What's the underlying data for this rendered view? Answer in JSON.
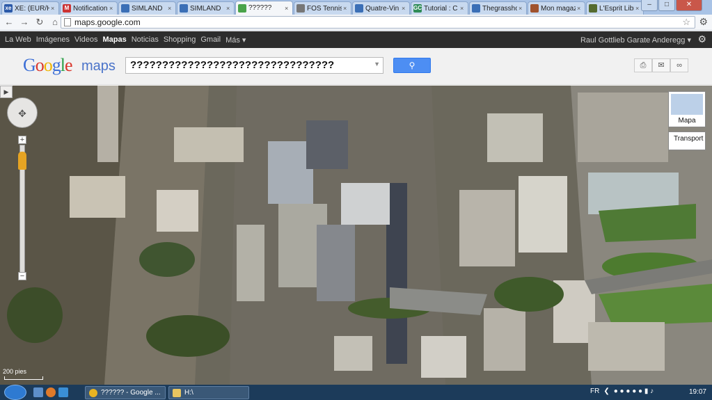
{
  "browser": {
    "tabs": [
      {
        "label": "XE: (EUR/H",
        "icon_text": "xe",
        "color": "#2b59a8"
      },
      {
        "label": "Notification",
        "icon_text": "M",
        "color": "#cc3333"
      },
      {
        "label": "SIMLAND",
        "icon_text": "",
        "color": "#3b6fb6"
      },
      {
        "label": "SIMLAND",
        "icon_text": "",
        "color": "#3b6fb6"
      },
      {
        "label": "??????",
        "icon_text": "",
        "color": "#4aa34a"
      },
      {
        "label": "FOS Tennis",
        "icon_text": "",
        "color": "#777777"
      },
      {
        "label": "Quatre-Vin",
        "icon_text": "",
        "color": "#3b6fb6"
      },
      {
        "label": "Tutorial : C",
        "icon_text": "GC",
        "color": "#2e8b57"
      },
      {
        "label": "Thegrassho",
        "icon_text": "",
        "color": "#3b6fb6"
      },
      {
        "label": "Mon magaz",
        "icon_text": "",
        "color": "#a0522d"
      },
      {
        "label": "L'Esprit Libr",
        "icon_text": "",
        "color": "#556b2f"
      }
    ],
    "active_tab_index": 4,
    "url": "maps.google.com",
    "window_controls": {
      "minimize": "–",
      "maximize": "□",
      "close": "✕"
    }
  },
  "google_bar": {
    "items": [
      "La Web",
      "Imágenes",
      "Videos",
      "Mapas",
      "Noticias",
      "Shopping",
      "Gmail",
      "Más ▾"
    ],
    "selected": "Mapas",
    "user": "Raul Gottlieb Garate Anderegg ▾"
  },
  "header": {
    "logo": "Google",
    "logo_suffix": "maps",
    "search_value": "????????????????????????????????",
    "search_button_icon": "search-icon"
  },
  "map": {
    "map_type_label": "Mapa",
    "transport_label": "Transport",
    "scale_label": "200 pies"
  },
  "taskbar": {
    "tasks": [
      {
        "label": "?????? - Google ...",
        "color": "#e8b422"
      },
      {
        "label": "H:\\",
        "color": "#e8c560"
      }
    ],
    "language": "FR",
    "clock": "19:07"
  },
  "colors": {
    "google_blue": "#4a73c9",
    "search_button": "#4d8ef3",
    "gbar_bg": "#2d2d2d",
    "taskbar_bg": "#1c3b5a"
  }
}
